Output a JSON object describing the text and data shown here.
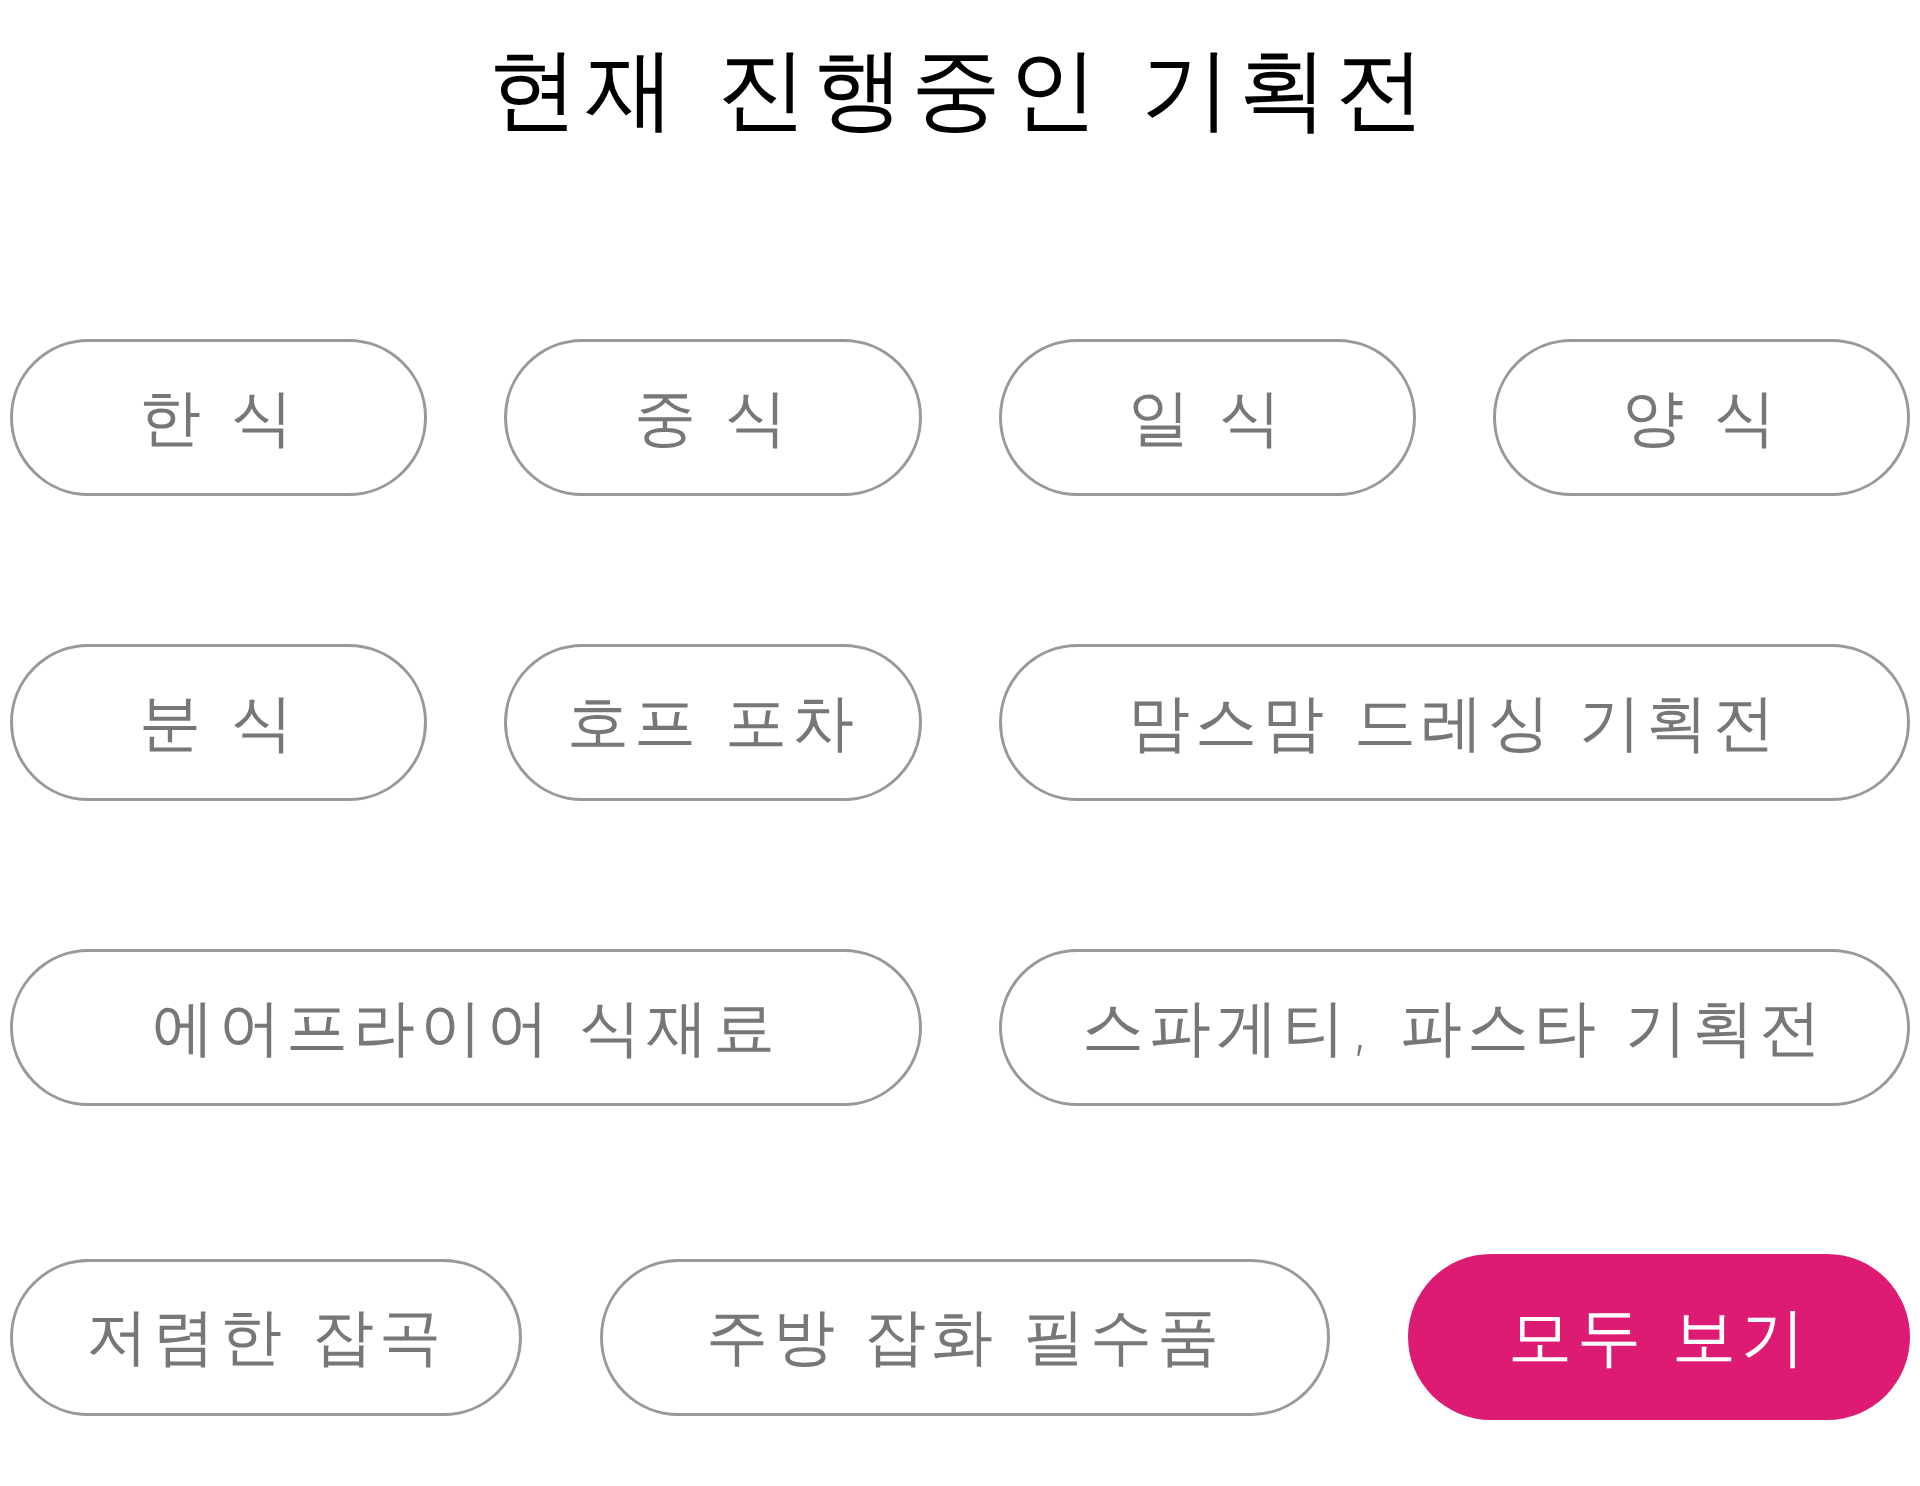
{
  "title": "현재 진행중인 기획전",
  "rows": [
    {
      "buttons": [
        {
          "label": "한 식",
          "kind": "outline"
        },
        {
          "label": "중 식",
          "kind": "outline"
        },
        {
          "label": "일 식",
          "kind": "outline"
        },
        {
          "label": "양 식",
          "kind": "outline"
        }
      ]
    },
    {
      "buttons": [
        {
          "label": "분 식",
          "kind": "outline"
        },
        {
          "label": "호프 포차",
          "kind": "outline"
        },
        {
          "label": "맘스맘 드레싱 기획전",
          "kind": "outline"
        }
      ]
    },
    {
      "buttons": [
        {
          "label": "에어프라이어 식재료",
          "kind": "outline"
        },
        {
          "label": "스파게티, 파스타 기획전",
          "kind": "outline"
        }
      ]
    },
    {
      "buttons": [
        {
          "label": "저렴한 잡곡",
          "kind": "outline"
        },
        {
          "label": "주방 잡화 필수품",
          "kind": "outline"
        },
        {
          "label": "모두 보기",
          "kind": "filled"
        }
      ]
    }
  ]
}
